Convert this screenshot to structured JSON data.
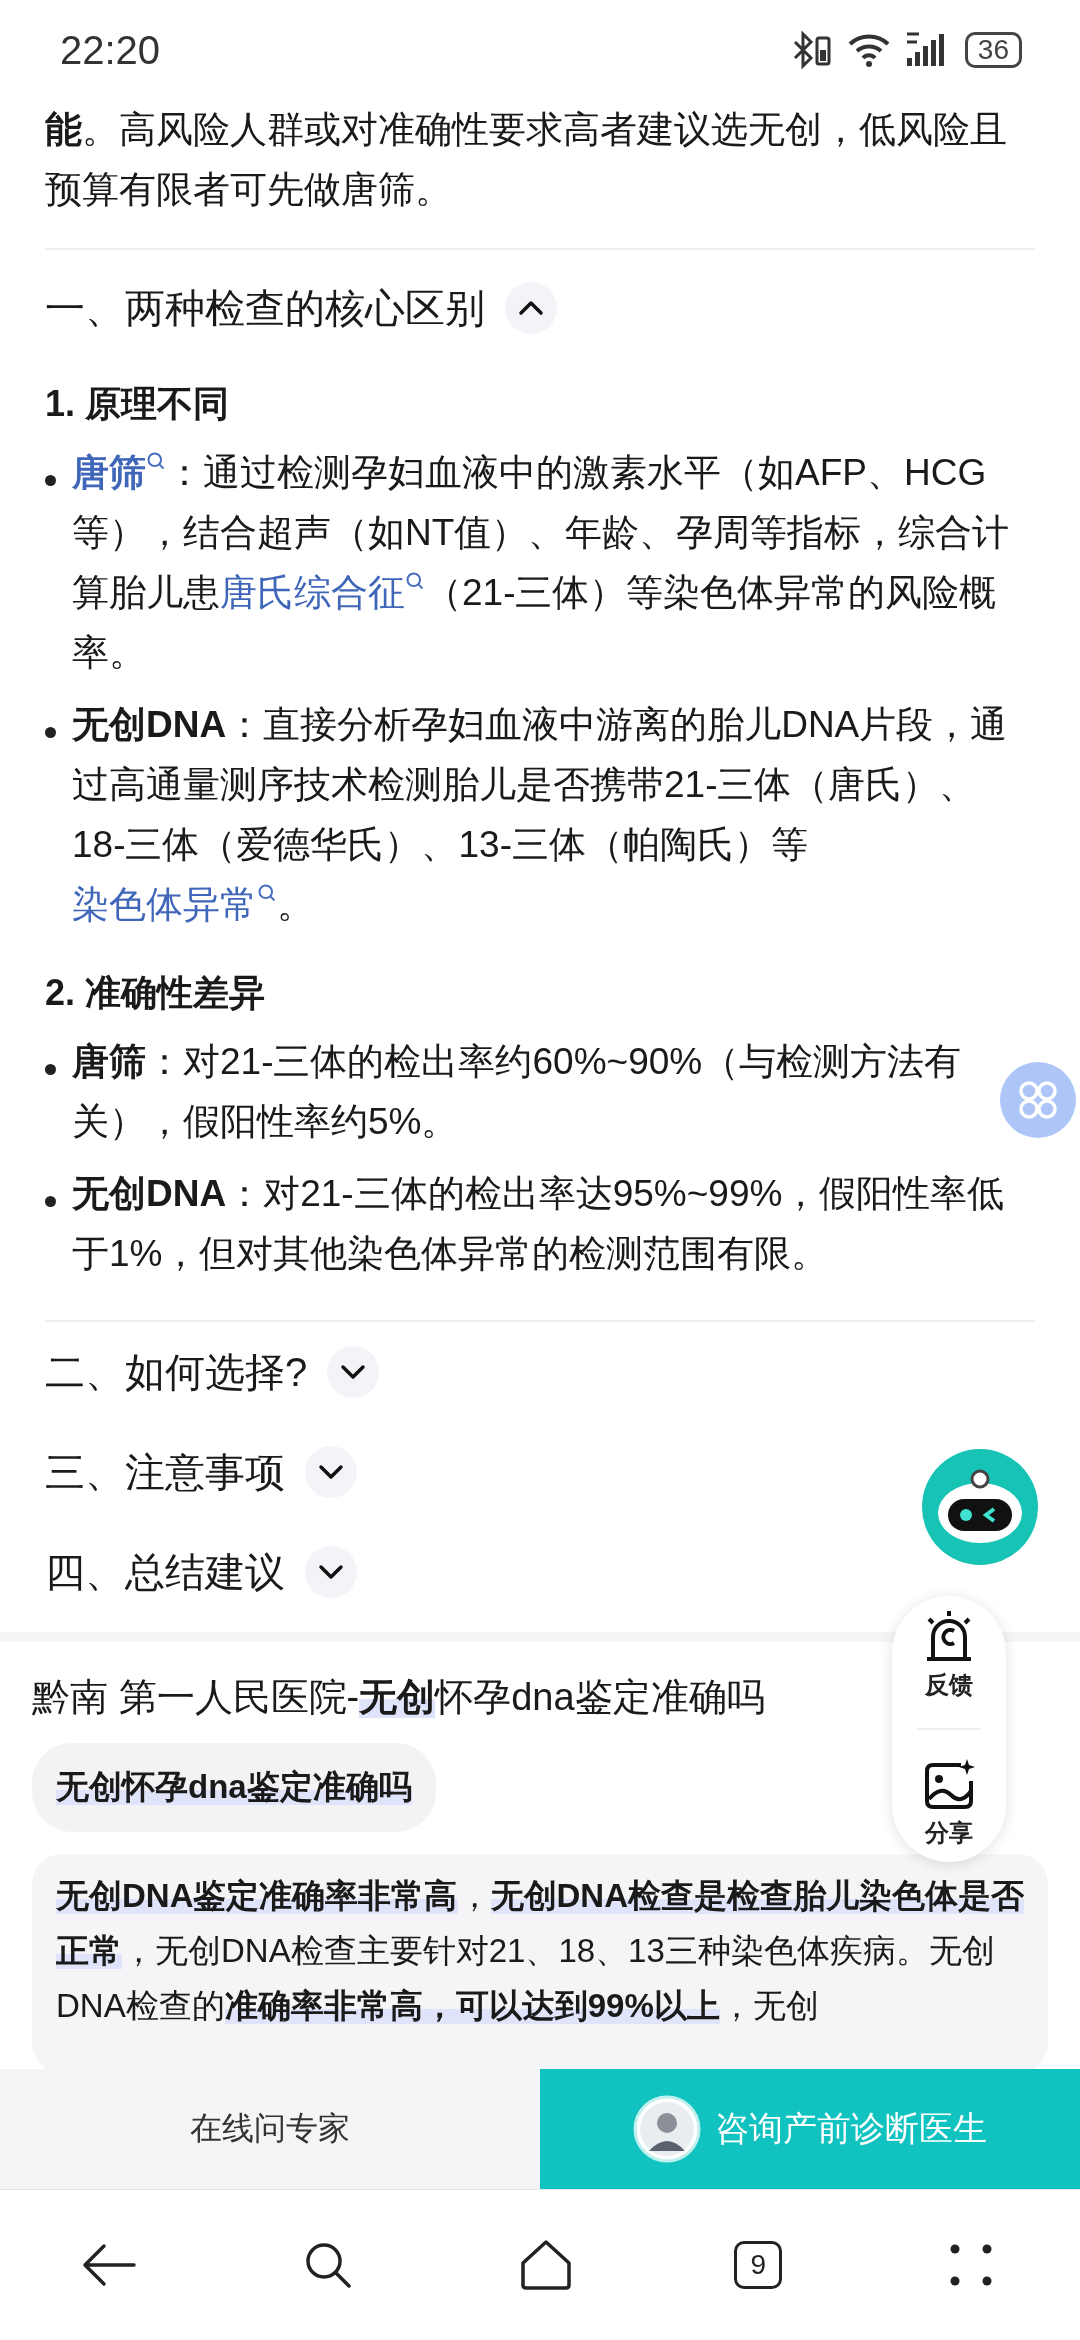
{
  "status_bar": {
    "time": "22:20",
    "battery": "36"
  },
  "intro": "**能**。高风险人群或对准确性要求高者建议选无创，低风险且预算有限者可先做唐筛。",
  "sections": [
    {
      "title": "一、两种检查的核心区别",
      "expanded": true,
      "groups": [
        {
          "title": "1. 原理不同",
          "bullets": [
            {
              "parts": [
                {
                  "kind": "term-link",
                  "text": "唐筛"
                },
                {
                  "kind": "text",
                  "text": "：通过检测孕妇血液中的激素水平（如AFP、HCG等），结合超声（如NT值）、年龄、孕周等指标，综合计算胎儿患"
                },
                {
                  "kind": "link",
                  "text": "唐氏综合征"
                },
                {
                  "kind": "text",
                  "text": "（21-三体）等染色体异常的风险概率。"
                }
              ]
            },
            {
              "parts": [
                {
                  "kind": "term",
                  "text": "无创DNA"
                },
                {
                  "kind": "text",
                  "text": "：直接分析孕妇血液中游离的胎儿DNA片段，通过高通量测序技术检测胎儿是否携带21-三体（唐氏）、18-三体（爱德华氏）、13-三体（帕陶氏）等"
                },
                {
                  "kind": "link",
                  "text": "染色体异常"
                },
                {
                  "kind": "text",
                  "text": "。"
                }
              ]
            }
          ]
        },
        {
          "title": "2. 准确性差异",
          "bullets": [
            {
              "parts": [
                {
                  "kind": "term",
                  "text": "唐筛"
                },
                {
                  "kind": "text",
                  "text": "：对21-三体的检出率约60%~90%（与检测方法有关），假阳性率约5%。"
                }
              ]
            },
            {
              "parts": [
                {
                  "kind": "term",
                  "text": "无创DNA"
                },
                {
                  "kind": "text",
                  "text": "：对21-三体的检出率达95%~99%，假阳性率低于1%，但对其他染色体异常的检测范围有限。"
                }
              ]
            }
          ]
        }
      ]
    },
    {
      "title": "二、如何选择?",
      "expanded": false
    },
    {
      "title": "三、注意事项",
      "expanded": false
    },
    {
      "title": "四、总结建议",
      "expanded": false
    }
  ],
  "result": {
    "title": "黔南 第一人民医院-**无创**怀孕dna鉴定准确吗",
    "chip": "无创怀孕dna鉴定准确吗",
    "answer": "**无创DNA鉴定准确率非常高**，**无创DNA检查是检查胎儿染色体是否正常**，无创DNA检查主要针对21、18、13三种染色体疾病。无创DNA检查的**准确率非常高，可以达到99%以上**，无创"
  },
  "floating": {
    "feedback": "反馈",
    "share": "分享"
  },
  "action_bar": {
    "ask": "在线问专家",
    "consult": "咨询产前诊断医生"
  },
  "nav_bar": {
    "tabs_count": "9"
  }
}
